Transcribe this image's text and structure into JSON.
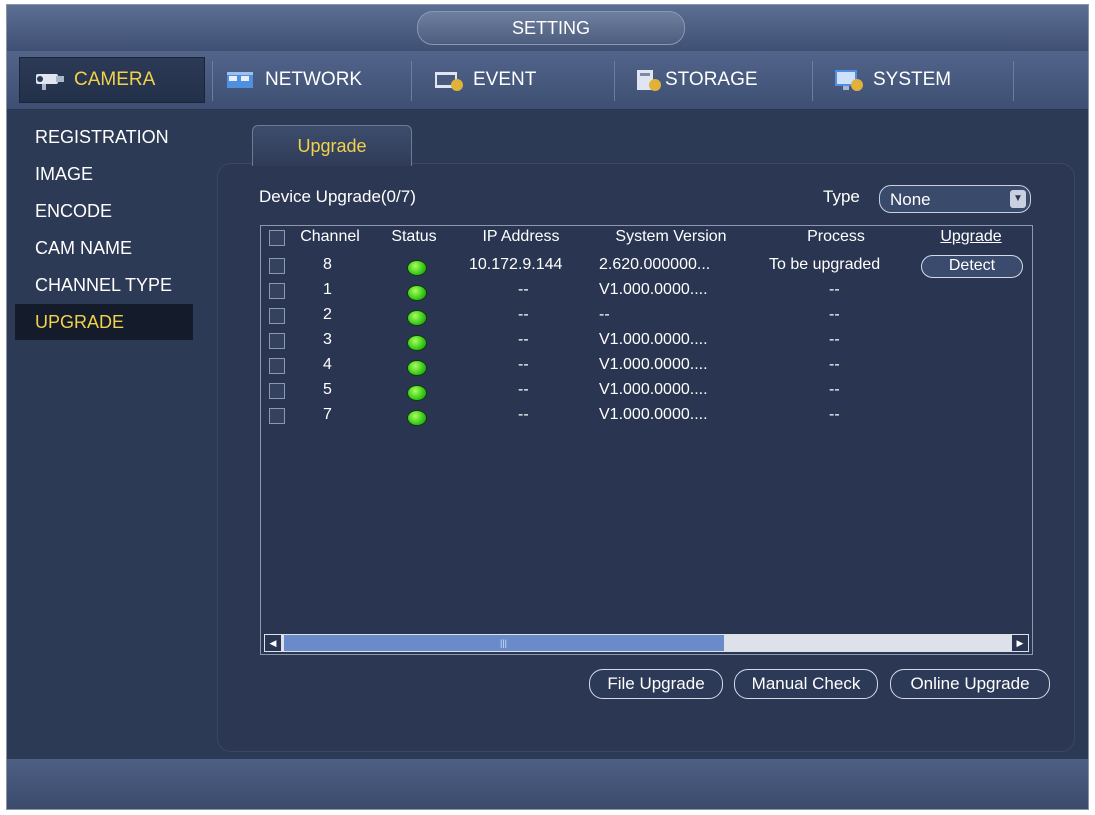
{
  "window": {
    "title": "SETTING"
  },
  "main_tabs": [
    {
      "label": "CAMERA",
      "icon": "camera-icon",
      "active": true
    },
    {
      "label": "NETWORK",
      "icon": "network-icon",
      "active": false
    },
    {
      "label": "EVENT",
      "icon": "event-icon",
      "active": false
    },
    {
      "label": "STORAGE",
      "icon": "storage-icon",
      "active": false
    },
    {
      "label": "SYSTEM",
      "icon": "system-icon",
      "active": false
    }
  ],
  "sidebar": {
    "items": [
      {
        "label": "REGISTRATION",
        "active": false
      },
      {
        "label": "IMAGE",
        "active": false
      },
      {
        "label": "ENCODE",
        "active": false
      },
      {
        "label": "CAM NAME",
        "active": false
      },
      {
        "label": "CHANNEL TYPE",
        "active": false
      },
      {
        "label": "UPGRADE",
        "active": true
      }
    ]
  },
  "subtab": {
    "label": "Upgrade"
  },
  "device_upgrade": {
    "title": "Device Upgrade(0/7)",
    "type_label": "Type",
    "type_value": "None"
  },
  "table": {
    "headers": {
      "channel": "Channel",
      "status": "Status",
      "ip": "IP Address",
      "version": "System Version",
      "process": "Process",
      "upgrade": "Upgrade"
    },
    "rows": [
      {
        "channel": "8",
        "status": "online",
        "ip": "10.172.9.144",
        "version": "2.620.000000...",
        "process": "To be upgraded",
        "upgrade": "Detect"
      },
      {
        "channel": "1",
        "status": "online",
        "ip": "--",
        "version": "V1.000.0000....",
        "process": "--",
        "upgrade": ""
      },
      {
        "channel": "2",
        "status": "online",
        "ip": "--",
        "version": "--",
        "process": "--",
        "upgrade": ""
      },
      {
        "channel": "3",
        "status": "online",
        "ip": "--",
        "version": "V1.000.0000....",
        "process": "--",
        "upgrade": ""
      },
      {
        "channel": "4",
        "status": "online",
        "ip": "--",
        "version": "V1.000.0000....",
        "process": "--",
        "upgrade": ""
      },
      {
        "channel": "5",
        "status": "online",
        "ip": "--",
        "version": "V1.000.0000....",
        "process": "--",
        "upgrade": ""
      },
      {
        "channel": "7",
        "status": "online",
        "ip": "--",
        "version": "V1.000.0000....",
        "process": "--",
        "upgrade": ""
      }
    ]
  },
  "buttons": {
    "file_upgrade": "File Upgrade",
    "manual_check": "Manual Check",
    "online_upgrade": "Online Upgrade"
  },
  "colors": {
    "active_text": "#f2d24a",
    "panel_bg": "#2c3853",
    "status_online": "#35c61a"
  }
}
